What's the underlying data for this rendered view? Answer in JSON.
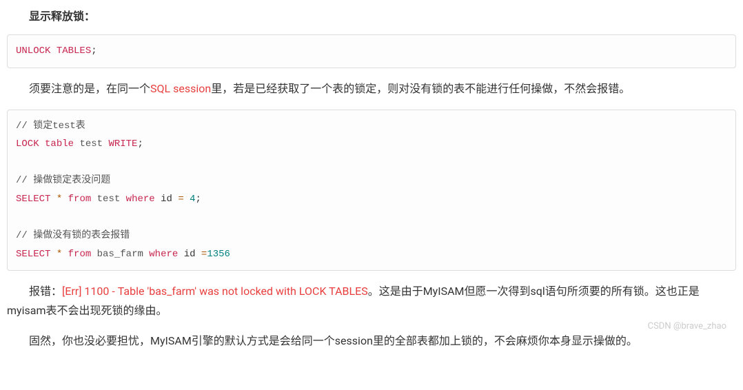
{
  "s1": {
    "title": "显示释放锁："
  },
  "code1": {
    "l1": {
      "unlock": "UNLOCK",
      "tables": "TABLES",
      "semi": ";"
    }
  },
  "p1": {
    "a": "须要注意的是，在同一个",
    "b": "SQL session",
    "c": "里，若是已经获取了一个表的锁定，则对没有锁的表不能进行任何操做，不然会报错。"
  },
  "code2": {
    "c1": "// 锁定test表",
    "l2": {
      "lock": "LOCK",
      "table": "table",
      "name": "test",
      "write": "WRITE",
      "semi": ";"
    },
    "c2": "// 操做锁定表没问题",
    "l4": {
      "select": "SELECT",
      "star": "*",
      "from": "from",
      "name": "test",
      "where": "where",
      "id": "id",
      "eq": "=",
      "val": "4",
      "semi": ";"
    },
    "c3": "// 操做没有锁的表会报错",
    "l6": {
      "select": "SELECT",
      "star": "*",
      "from": "from",
      "name": "bas_farm",
      "where": "where",
      "id": "id",
      "eq": "=",
      "val": "1356"
    }
  },
  "p2": {
    "a": "报错：",
    "err": "[Err] 1100 - Table 'bas_farm' was not locked with LOCK TABLES",
    "b": "。这是由于MyISAM但愿一次得到sql语句所须要的所有锁。这也正是myisam表不会出现死锁的缘由。"
  },
  "p3": {
    "a": "固然，你也没必要担忧，MyISAM引擎的默认方式是会给同一个session里的全部表都加上锁的，不会麻烦你本身显示操做的。"
  },
  "watermark": "CSDN @brave_zhao"
}
